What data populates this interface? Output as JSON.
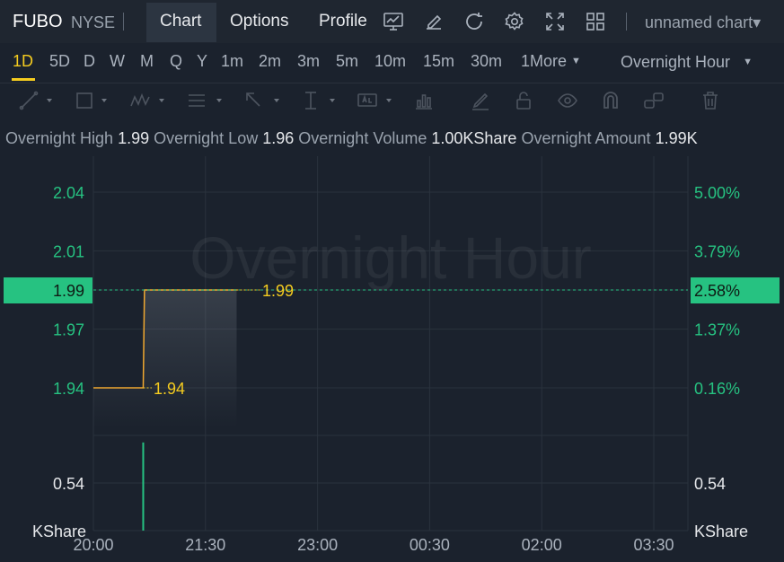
{
  "header": {
    "ticker": "FUBO",
    "exchange": "NYSE",
    "separator": "|",
    "tabs": [
      {
        "label": "Chart",
        "active": true
      },
      {
        "label": "Options",
        "active": false
      },
      {
        "label": "Profile",
        "active": false
      }
    ],
    "icons": [
      "indicator-icon",
      "draw-icon",
      "refresh-icon",
      "settings-icon",
      "fullscreen-icon",
      "layout-icon"
    ],
    "chart_name": "unnamed chart▾"
  },
  "timeframes": {
    "items": [
      "1D",
      "5D",
      "D",
      "W",
      "M",
      "Q",
      "Y",
      "1m",
      "2m",
      "3m",
      "5m",
      "10m",
      "15m",
      "30m",
      "1More"
    ],
    "active": "1D",
    "session": "Overnight Hour"
  },
  "drawing_tools": [
    "line-tool-icon",
    "rectangle-tool-icon",
    "pattern-tool-icon",
    "fib-tool-icon",
    "arrow-tool-icon",
    "measure-tool-icon",
    "text-tool-icon",
    "indicator-tool-icon",
    "pen-tool-icon",
    "lock-icon",
    "visibility-icon",
    "magnet-icon",
    "link-icon",
    "trash-icon"
  ],
  "info": {
    "high_label": "Overnight High",
    "high_value": "1.99",
    "low_label": "Overnight Low",
    "low_value": "1.96",
    "volume_label": "Overnight Volume",
    "volume_value": "1.00KShare",
    "amount_label": "Overnight Amount",
    "amount_value": "1.99K"
  },
  "colors": {
    "accent": "#f5cc1f",
    "up": "#26c281",
    "line": "#f0a830",
    "background": "#1b222d"
  },
  "chart_data": {
    "type": "line",
    "watermark": "Overnight Hour",
    "x_ticks": [
      "20:00",
      "21:30",
      "23:00",
      "00:30",
      "02:00",
      "03:30"
    ],
    "price_axis": {
      "ticks": [
        2.04,
        2.01,
        1.99,
        1.97,
        1.94
      ],
      "labels": [
        "2.04",
        "2.01",
        "1.99",
        "1.97",
        "1.94"
      ],
      "current": "1.99"
    },
    "percent_axis": {
      "labels": [
        "5.00%",
        "3.79%",
        "2.58%",
        "1.37%",
        "0.16%"
      ],
      "current": "2.58%"
    },
    "volume_axis": {
      "tick": "0.54",
      "unit": "KShare"
    },
    "series": [
      {
        "x": [
          "20:00",
          "20:40",
          "20:41",
          "21:55"
        ],
        "y": [
          1.94,
          1.94,
          1.99,
          1.99
        ]
      }
    ],
    "price_labels": [
      {
        "price": 1.99,
        "text": "1.99"
      },
      {
        "price": 1.94,
        "text": "1.94"
      }
    ],
    "volume_bars": [
      {
        "x": "20:40",
        "value": 1.0
      }
    ]
  }
}
